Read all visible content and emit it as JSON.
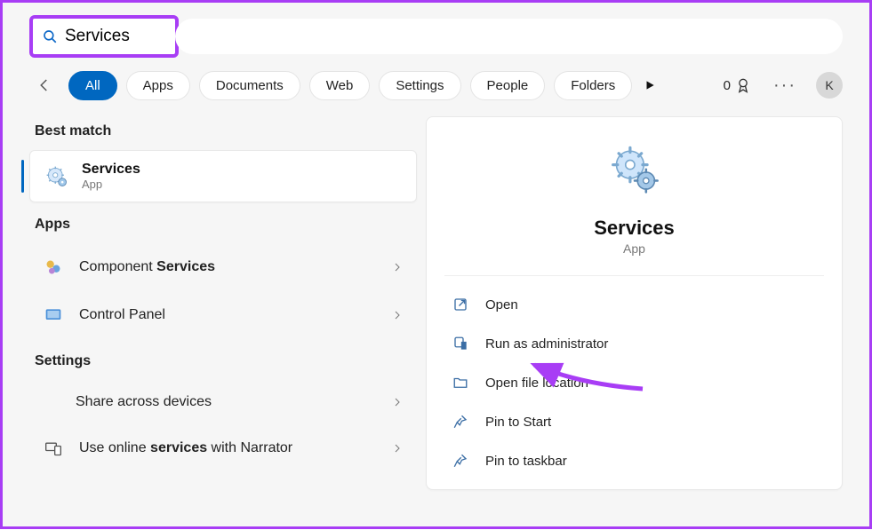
{
  "search": {
    "query": "Services"
  },
  "tabs": [
    "All",
    "Apps",
    "Documents",
    "Web",
    "Settings",
    "People",
    "Folders"
  ],
  "rewards_count": "0",
  "avatar_letter": "K",
  "sections": {
    "best_match": "Best match",
    "apps": "Apps",
    "settings": "Settings"
  },
  "best_match": {
    "title": "Services",
    "subtitle": "App"
  },
  "apps_list": [
    {
      "prefix": "Component ",
      "bold": "Services"
    },
    {
      "prefix": "Control Panel",
      "bold": ""
    }
  ],
  "settings_list": [
    {
      "text": "Share across devices"
    },
    {
      "prefix": "Use online ",
      "bold": "services",
      "suffix": " with Narrator"
    }
  ],
  "detail": {
    "title": "Services",
    "subtitle": "App"
  },
  "actions": [
    "Open",
    "Run as administrator",
    "Open file location",
    "Pin to Start",
    "Pin to taskbar"
  ]
}
